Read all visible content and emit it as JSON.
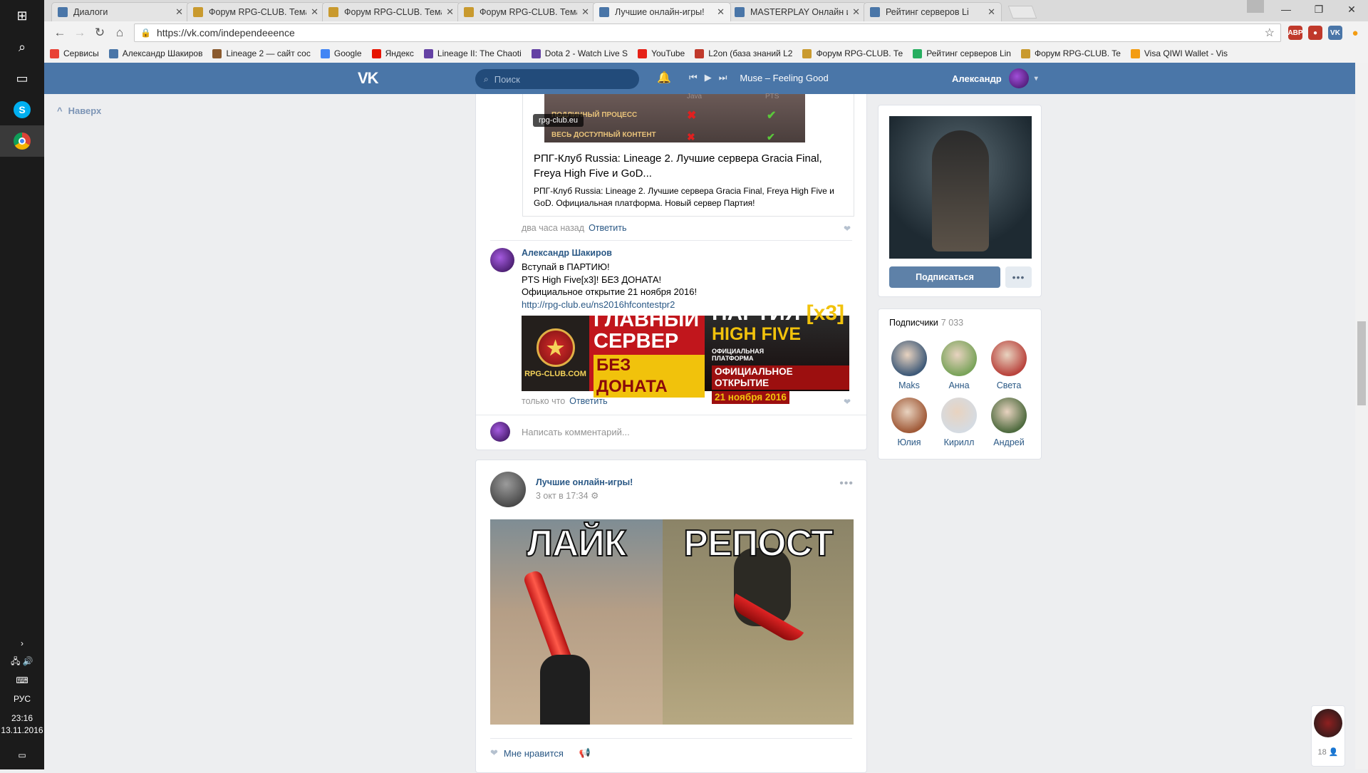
{
  "taskbar": {
    "lang": "РУС",
    "time": "23:16",
    "date": "13.11.2016"
  },
  "browser": {
    "tabs": [
      {
        "title": "Диалоги",
        "color": "#4a76a8"
      },
      {
        "title": "Форум RPG-CLUB. Тема",
        "color": "#c99a2e"
      },
      {
        "title": "Форум RPG-CLUB. Тема",
        "color": "#c99a2e"
      },
      {
        "title": "Форум RPG-CLUB. Тема",
        "color": "#c99a2e"
      },
      {
        "title": "Лучшие онлайн-игры!",
        "color": "#4a76a8"
      },
      {
        "title": "MASTERPLAY Онлайн иг",
        "color": "#4a76a8"
      },
      {
        "title": "Рейтинг серверов Li",
        "color": "#4a76a8"
      }
    ],
    "active_tab": 4,
    "url": "https://vk.com/independeeence",
    "bookmarks": [
      {
        "label": "Сервисы",
        "color": "#e94235"
      },
      {
        "label": "Александр Шакиров",
        "color": "#4a76a8"
      },
      {
        "label": "Lineage 2 — сайт сос",
        "color": "#8a5a2e"
      },
      {
        "label": "Google",
        "color": "#4285f4"
      },
      {
        "label": "Яндекс",
        "color": "#e61400"
      },
      {
        "label": "Lineage II: The Chaoti",
        "color": "#6441a4"
      },
      {
        "label": "Dota 2 - Watch Live S",
        "color": "#6441a4"
      },
      {
        "label": "YouTube",
        "color": "#e62117"
      },
      {
        "label": "L2on (база знаний L2",
        "color": "#c0392b"
      },
      {
        "label": "Форум RPG-CLUB. Те",
        "color": "#c99a2e"
      },
      {
        "label": "Рейтинг серверов Lin",
        "color": "#27ae60"
      },
      {
        "label": "Форум RPG-CLUB. Te",
        "color": "#c99a2e"
      },
      {
        "label": "Visa QIWI Wallet - Vis",
        "color": "#f39c12"
      }
    ]
  },
  "vk": {
    "logo": "VK",
    "search_placeholder": "Поиск",
    "player_track": "Muse – Feeling Good",
    "user_name": "Александр",
    "back_to_top": "Наверх"
  },
  "feed": {
    "snippet": {
      "image_rows": [
        "ПОДЛИННЫЙ ПРОЦЕСС",
        "ВЕСЬ ДОСТУПНЫЙ КОНТЕНТ"
      ],
      "col_java": "Java",
      "col_pts": "PTS",
      "domain": "rpg-club.eu",
      "title": "РПГ-Клуб Russia: Lineage 2. Лучшие сервера Gracia Final, Freya High Five и GoD...",
      "description": "РПГ-Клуб Russia: Lineage 2. Лучшие сервера Gracia Final, Freya High Five и GoD. Официальная платформа. Новый сервер Партия!"
    },
    "comment1_time": "два часа назад",
    "reply_label": "Ответить",
    "comment2": {
      "author": "Александр Шакиров",
      "line1": "Вступай в ПАРТИЮ!",
      "line2": "PTS High Five[x3]! БЕЗ ДОНАТА!",
      "line3": "Официальное открытие 21 ноября 2016!",
      "link": "http://rpg-club.eu/ns2016hfcontestpr2",
      "time": "только что",
      "banner": {
        "site": "RPG-CLUB.COM",
        "main1": "ГЛАВНЫЙ",
        "main2": "СЕРВЕР",
        "no_donate": "БЕЗ ДОНАТА",
        "party": "ПАРТИЯ",
        "rate": "[x3]",
        "hf": "HIGH FIVE",
        "platform": "ОФИЦИАЛЬНАЯ ПЛАТФОРМА",
        "open1": "ОФИЦИАЛЬНОЕ ОТКРЫТИЕ",
        "open2": "21 ноября 2016"
      }
    },
    "write_comment": "Написать комментарий..."
  },
  "post": {
    "author": "Лучшие онлайн-игры!",
    "date": "3 окт в 17:34",
    "word_left": "ЛАЙК",
    "word_right": "РЕПОСТ",
    "like_label": "Мне нравится"
  },
  "sidebar": {
    "subscribe_label": "Подписаться",
    "subscribers_title": "Подписчики",
    "subscribers_count": "7 033",
    "subscribers": [
      {
        "name": "Maks",
        "color": "#3f5a78"
      },
      {
        "name": "Анна",
        "color": "#7aa35a"
      },
      {
        "name": "Света",
        "color": "#b9443d"
      },
      {
        "name": "Юлия",
        "color": "#a05a38"
      },
      {
        "name": "Кирилл",
        "color": "#d5dbe2"
      },
      {
        "name": "Андрей",
        "color": "#4f6b3f"
      }
    ]
  },
  "chat_count": "18"
}
